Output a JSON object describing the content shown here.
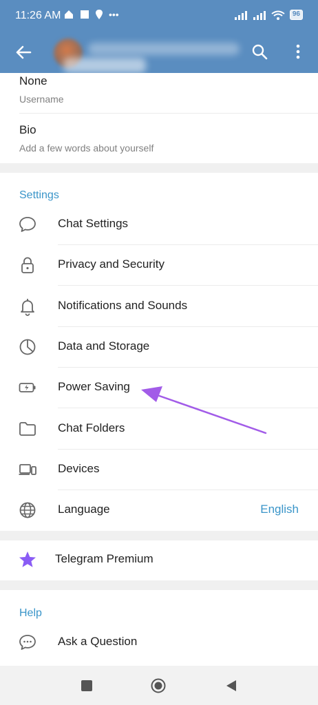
{
  "status_bar": {
    "time": "11:26 AM",
    "battery": "96"
  },
  "profile": {
    "username": {
      "value": "None",
      "label": "Username"
    },
    "bio": {
      "value": "Bio",
      "label": "Add a few words about yourself"
    }
  },
  "settings": {
    "title": "Settings",
    "items": [
      {
        "label": "Chat Settings",
        "icon": "chat-bubble-icon"
      },
      {
        "label": "Privacy and Security",
        "icon": "lock-icon"
      },
      {
        "label": "Notifications and Sounds",
        "icon": "bell-icon"
      },
      {
        "label": "Data and Storage",
        "icon": "pie-chart-icon"
      },
      {
        "label": "Power Saving",
        "icon": "battery-bolt-icon"
      },
      {
        "label": "Chat Folders",
        "icon": "folder-icon"
      },
      {
        "label": "Devices",
        "icon": "devices-icon"
      },
      {
        "label": "Language",
        "icon": "globe-icon",
        "value": "English"
      }
    ]
  },
  "premium": {
    "label": "Telegram Premium",
    "icon": "star-icon",
    "color": "#8a5cf5"
  },
  "help": {
    "title": "Help",
    "items": [
      {
        "label": "Ask a Question",
        "icon": "question-bubble-icon"
      }
    ]
  },
  "colors": {
    "header": "#5a8dc0",
    "accent": "#3a95c9",
    "annotation_arrow": "#a25ce8"
  }
}
